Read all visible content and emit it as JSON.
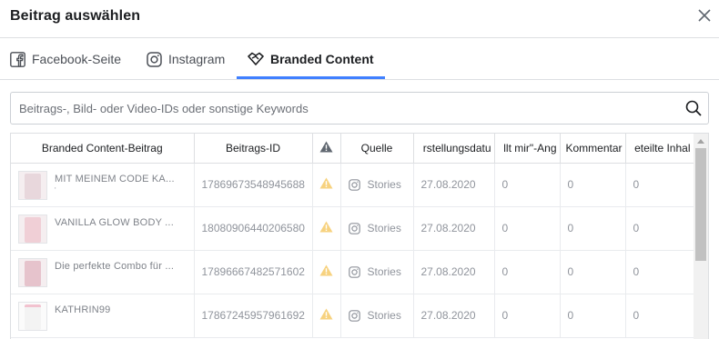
{
  "dialog": {
    "title": "Beitrag auswählen"
  },
  "tabs": [
    {
      "label": "Facebook-Seite",
      "icon": "facebook-icon",
      "active": false
    },
    {
      "label": "Instagram",
      "icon": "instagram-icon",
      "active": false
    },
    {
      "label": "Branded Content",
      "icon": "handshake-icon",
      "active": true
    }
  ],
  "search": {
    "placeholder": "Beitrags-, Bild- oder Video-IDs oder sonstige Keywords",
    "value": ""
  },
  "table": {
    "columns": [
      "Branded Content-Beitrag",
      "Beitrags-ID",
      "warning-icon",
      "Quelle",
      "rstellungsdatu",
      "llt mir\"-Ang",
      "Kommentar",
      "eteilte Inhal"
    ],
    "rows": [
      {
        "post": "MIT MEINEM CODE KA...",
        "sub": "'",
        "id": "17869673548945688",
        "source": "Stories",
        "date": "27.08.2020",
        "likes": "0",
        "comments": "0",
        "shares": "0"
      },
      {
        "post": "VANILLA GLOW BODY ...",
        "sub": "",
        "id": "18080906440206580",
        "source": "Stories",
        "date": "27.08.2020",
        "likes": "0",
        "comments": "0",
        "shares": "0"
      },
      {
        "post": "Die perfekte Combo für ...",
        "sub": "",
        "id": "17896667482571602",
        "source": "Stories",
        "date": "27.08.2020",
        "likes": "0",
        "comments": "0",
        "shares": "0"
      },
      {
        "post": "KATHRIN99",
        "sub": "",
        "id": "17867245957961692",
        "source": "Stories",
        "date": "27.08.2020",
        "likes": "0",
        "comments": "0",
        "shares": "0"
      }
    ]
  },
  "colors": {
    "accent": "#4080ff",
    "warning": "#f7b928"
  }
}
